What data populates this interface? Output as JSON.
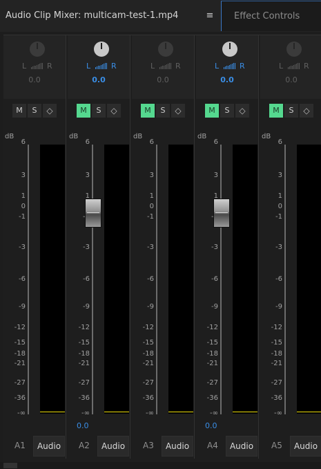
{
  "window": {
    "title": "Audio Clip Mixer: multicam-test-1.mp4",
    "menu_icon": "hamburger-icon",
    "other_tab": "Effect Controls"
  },
  "channels": [
    {
      "name": "A1",
      "output": "Audio",
      "pan": "0.0",
      "pan_label_l": "L",
      "pan_label_r": "R",
      "active": false,
      "mute": false,
      "solo": false,
      "volume": "",
      "show_fader": false
    },
    {
      "name": "A2",
      "output": "Audio",
      "pan": "0.0",
      "pan_label_l": "L",
      "pan_label_r": "R",
      "active": true,
      "mute": true,
      "solo": false,
      "volume": "0.0",
      "show_fader": true
    },
    {
      "name": "A3",
      "output": "Audio",
      "pan": "0.0",
      "pan_label_l": "L",
      "pan_label_r": "R",
      "active": false,
      "mute": true,
      "solo": false,
      "volume": "",
      "show_fader": false
    },
    {
      "name": "A4",
      "output": "Audio",
      "pan": "0.0",
      "pan_label_l": "L",
      "pan_label_r": "R",
      "active": true,
      "mute": true,
      "solo": false,
      "volume": "0.0",
      "show_fader": true
    },
    {
      "name": "A5",
      "output": "Audio",
      "pan": "0.0",
      "pan_label_l": "L",
      "pan_label_r": "R",
      "active": false,
      "mute": true,
      "solo": false,
      "volume": "",
      "show_fader": false
    }
  ],
  "buttons": {
    "mute": "M",
    "solo": "S",
    "keyframe": "◇"
  },
  "meter": {
    "unit": "dB",
    "ticks": [
      "6",
      "3",
      "1",
      "0",
      "-1",
      "-3",
      "-6",
      "-9",
      "-12",
      "-15",
      "-18",
      "-21",
      "-27",
      "-36",
      "-∞"
    ]
  },
  "colors": {
    "accent_blue": "#3a8ee6",
    "mute_green": "#55d88f",
    "meter_peak": "#f2e20b"
  }
}
